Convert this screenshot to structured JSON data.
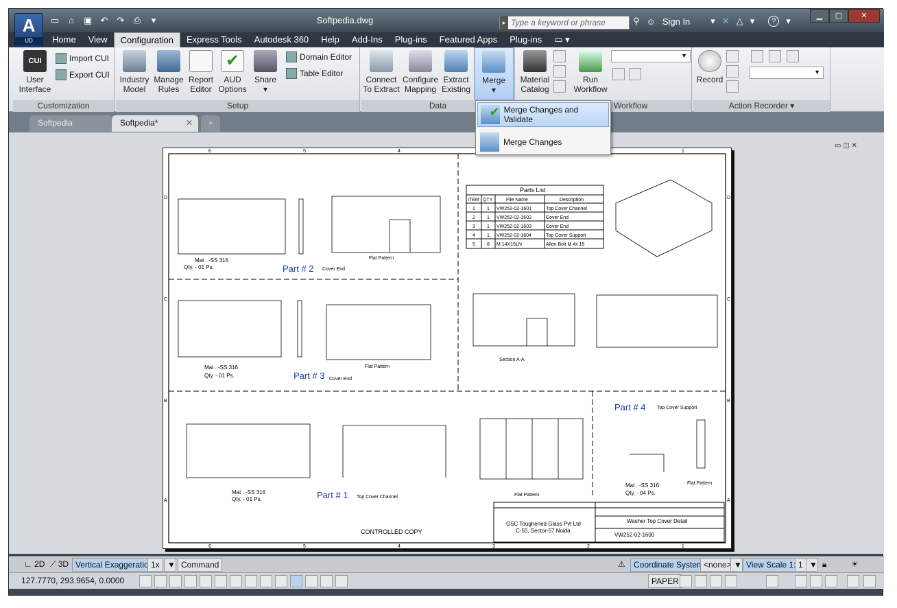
{
  "window": {
    "title": "Softpedia.dwg",
    "search_placeholder": "Type a keyword or phrase",
    "sign_in": "Sign In",
    "app_badge": "UD"
  },
  "menu": [
    "Home",
    "View",
    "Configuration",
    "Express Tools",
    "Autodesk 360",
    "Help",
    "Add-Ins",
    "Plug-ins",
    "Featured Apps",
    "Plug-ins"
  ],
  "ribbon": {
    "customization": {
      "label": "Customization",
      "user_interface": "User Interface",
      "import_cui": "Import CUI",
      "export_cui": "Export CUI",
      "cui_badge": "CUI"
    },
    "setup": {
      "label": "Setup",
      "industry_model": "Industry Model",
      "manage_rules": "Manage Rules",
      "report_editor": "Report Editor",
      "aud_options": "AUD Options",
      "share": "Share",
      "domain_editor": "Domain Editor",
      "table_editor": "Table Editor"
    },
    "data": {
      "label": "Data",
      "connect": "Connect To Extract",
      "configure": "Configure Mapping",
      "extract": "Extract Existing",
      "merge": "Merge"
    },
    "workflow": {
      "label": "Workflow",
      "material": "Material Catalog",
      "run": "Run Workflow"
    },
    "action": {
      "label": "Action Recorder",
      "record": "Record"
    }
  },
  "merge_menu": {
    "item1": "Merge Changes and Validate",
    "item2": "Merge Changes"
  },
  "doc_tabs": [
    "Softpedia",
    "Softpedia*"
  ],
  "drawing": {
    "parts_list": {
      "title": "Parts List",
      "headers": [
        "ITEM",
        "QTY",
        "File Name",
        "Description"
      ],
      "rows": [
        [
          "1",
          "1",
          "VW252-02-1601",
          "Top Cover Channel"
        ],
        [
          "2",
          "1",
          "VW252-02-1602",
          "Cover End"
        ],
        [
          "3",
          "1",
          "VW252-02-1603",
          "Cover End"
        ],
        [
          "4",
          "1",
          "VW252-02-1604",
          "Top Cover Support"
        ],
        [
          "5",
          "8",
          "M 14X15LN",
          "Allen Bolt M 4x 15"
        ]
      ]
    },
    "part2": "Part # 2",
    "part2_sub": "Cover End",
    "part3": "Part # 3",
    "part3_sub": "Cover End",
    "part1": "Part # 1",
    "part1_sub": "Top Cover Channel",
    "part4": "Part # 4",
    "part4_sub": "Top Cover Support",
    "mat": "Mat . -SS 316",
    "qty1": "Qty. - 01 Ps.",
    "qty4": "Qty. - 04 Ps.",
    "flat": "Flat Pattern",
    "section": "Section A-A",
    "controlled": "CONTROLLED COPY",
    "company": "GSC Toughened Glass Pvt Ltd",
    "address": "C-50, Sector-57 Noida",
    "drawing_title": "Washer Top Cover Detail",
    "drawing_no": "VW252-02-1600",
    "col_labels": [
      "6",
      "5",
      "4",
      "3",
      "2",
      "1"
    ],
    "row_labels": [
      "D",
      "C",
      "B",
      "A"
    ]
  },
  "status1": {
    "mode2d": "2D",
    "mode3d": "3D",
    "vexag": "Vertical Exaggeration:",
    "vexag_val": "1x",
    "command": "Command",
    "coord_sys": "Coordinate System:",
    "coord_val": "<none>",
    "view_scale": "View Scale",
    "scale_val": "1"
  },
  "status2": {
    "coords": "127.7770, 293.9654, 0.0000",
    "paper": "PAPER"
  }
}
